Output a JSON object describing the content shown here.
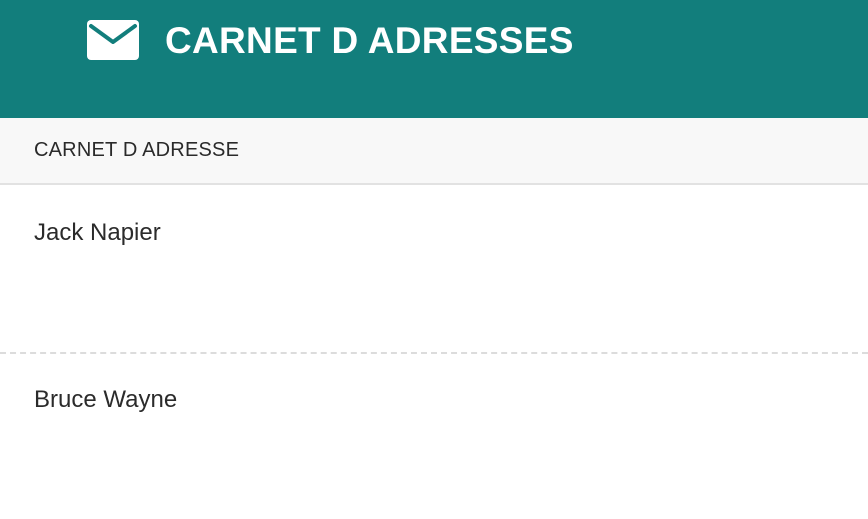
{
  "header": {
    "title": "CARNET D ADRESSES",
    "icon": "envelope-icon",
    "background_color": "#127e7c"
  },
  "section": {
    "title": "CARNET D ADRESSE"
  },
  "contacts": [
    {
      "name": "Jack Napier"
    },
    {
      "name": "Bruce Wayne"
    }
  ]
}
